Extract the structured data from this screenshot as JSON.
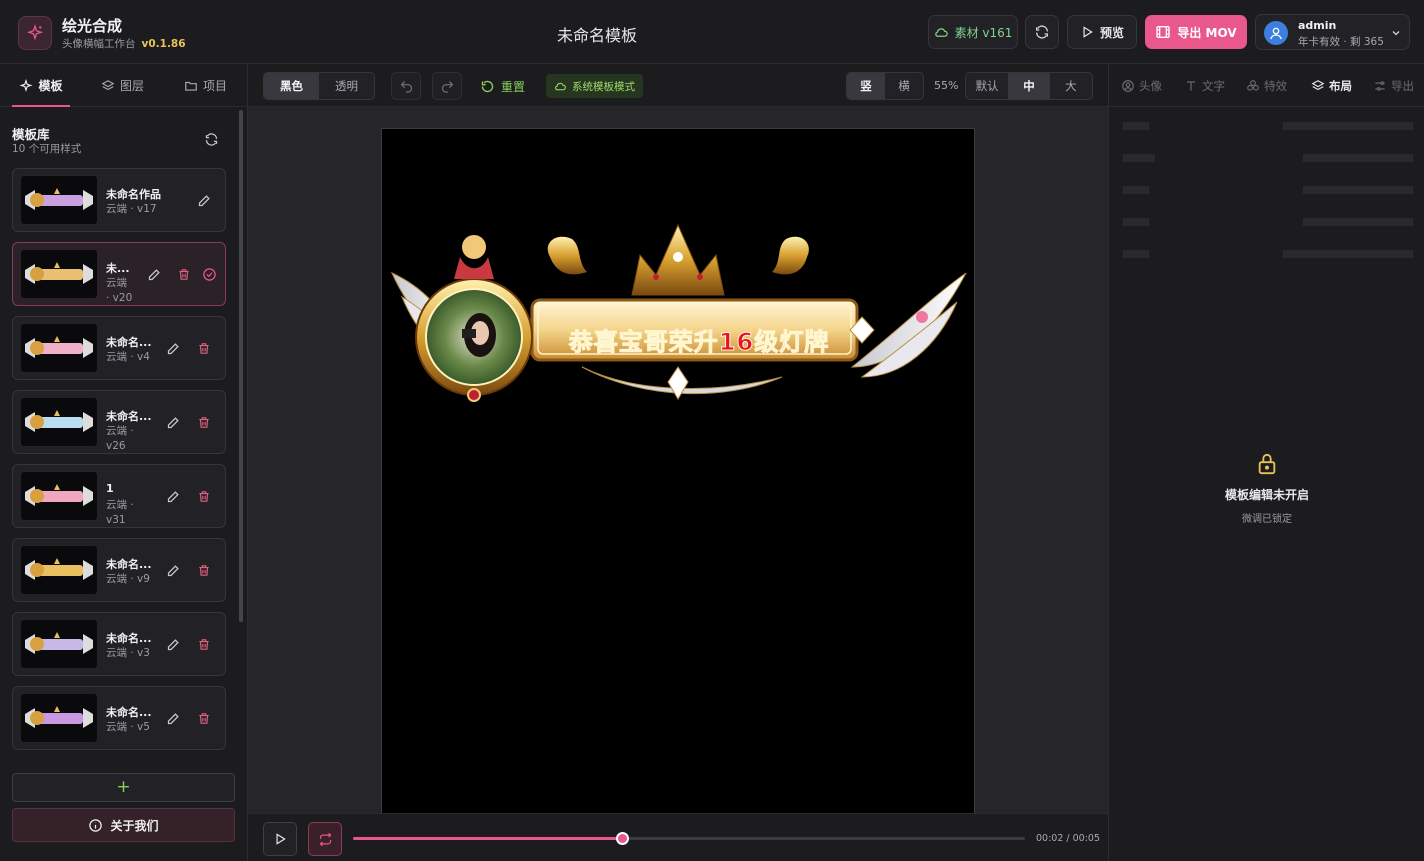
{
  "header": {
    "app_name": "绘光合成",
    "app_subtitle": "头像横幅工作台",
    "version": "v0.1.86",
    "doc_title": "未命名模板",
    "material_label": "素材 v161",
    "preview_label": "预览",
    "export_label": "导出 MOV",
    "user": {
      "name": "admin",
      "info": "年卡有效 · 剩 365"
    }
  },
  "left_panel": {
    "tabs": [
      {
        "label": "模板",
        "icon": "sparkle-icon",
        "active": true
      },
      {
        "label": "图层",
        "icon": "layers-icon",
        "active": false
      },
      {
        "label": "项目",
        "icon": "folder-icon",
        "active": false
      }
    ],
    "library_title": "模板库",
    "library_count": "10 个可用样式",
    "templates": [
      {
        "name": "未命名作品",
        "meta1": "云端 · v17",
        "meta2": "",
        "selected": false
      },
      {
        "name": "未...",
        "meta1": "云端",
        "meta2": "· v20",
        "selected": true
      },
      {
        "name": "未命名...",
        "meta1": "云端 · v4",
        "meta2": "",
        "selected": false
      },
      {
        "name": "未命名...",
        "meta1": "云端 ·",
        "meta2": "v26",
        "selected": false
      },
      {
        "name": "1",
        "meta1": "云端 ·",
        "meta2": "v31",
        "selected": false
      },
      {
        "name": "未命名...",
        "meta1": "云端 · v9",
        "meta2": "",
        "selected": false
      },
      {
        "name": "未命名...",
        "meta1": "云端 · v3",
        "meta2": "",
        "selected": false
      },
      {
        "name": "未命名...",
        "meta1": "云端 · v5",
        "meta2": "",
        "selected": false
      }
    ],
    "add_label": "+",
    "about_label": "关于我们"
  },
  "toolbar": {
    "bg_options": [
      "黑色",
      "透明"
    ],
    "bg_selected": "黑色",
    "reset_label": "重置",
    "system_mode_label": "系统模板模式",
    "orientation_options": [
      "竖",
      "横"
    ],
    "orientation_selected": "竖",
    "zoom": "55%",
    "size_options": [
      "默认",
      "中",
      "大"
    ],
    "size_selected": "中"
  },
  "canvas": {
    "banner_text_red1": "恭喜",
    "banner_text_gold1": "宝哥",
    "banner_text_red2": "荣升16级灯牌"
  },
  "playback": {
    "progress": 0.4,
    "current_time": "00:02",
    "total_time": "00:05"
  },
  "right_panel": {
    "tabs": [
      {
        "label": "头像",
        "icon": "user-circle-icon",
        "active": false
      },
      {
        "label": "文字",
        "icon": "text-icon",
        "active": false
      },
      {
        "label": "特效",
        "icon": "effects-icon",
        "active": false
      },
      {
        "label": "布局",
        "icon": "layers-icon",
        "active": true
      },
      {
        "label": "导出",
        "icon": "sliders-icon",
        "active": false
      }
    ],
    "locked_title": "模板编辑未开启",
    "locked_subtitle": "微调已锁定"
  },
  "colors": {
    "accent": "#e8588a",
    "green": "#86d05a",
    "gold": "#e9c25a"
  }
}
